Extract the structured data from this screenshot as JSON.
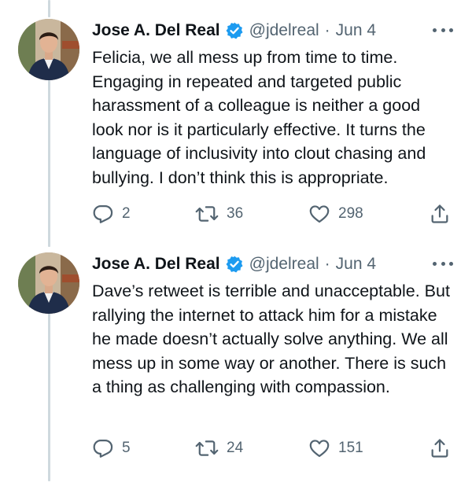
{
  "tweets": [
    {
      "author_name": "Jose A. Del Real",
      "handle": "@jdelreal",
      "separator": "·",
      "date": "Jun 4",
      "text": "Felicia, we all mess up from time to time. Engaging in repeated and targeted public harassment of a colleague is neither a good look nor is it particularly effective. It turns the language of inclusivity into clout chasing and bullying. I don’t think this is appropriate.",
      "replies": "2",
      "retweets": "36",
      "likes": "298"
    },
    {
      "author_name": "Jose A. Del Real",
      "handle": "@jdelreal",
      "separator": "·",
      "date": "Jun 4",
      "text": "Dave’s retweet is terrible and unacceptable. But rallying the internet to attack him for a mistake he made doesn’t actually solve anything. We all mess up in some way or another. There is such a thing as challenging with compassion.",
      "replies": "5",
      "retweets": "24",
      "likes": "151"
    }
  ],
  "colors": {
    "text_primary": "#0f1419",
    "text_secondary": "#536471",
    "verified_blue": "#1d9bf0",
    "thread_line": "#cfd9de"
  },
  "icons": {
    "verified": "verified-badge-icon",
    "more": "more-dots-icon",
    "reply": "reply-icon",
    "retweet": "retweet-icon",
    "like": "heart-icon",
    "share": "share-icon"
  }
}
